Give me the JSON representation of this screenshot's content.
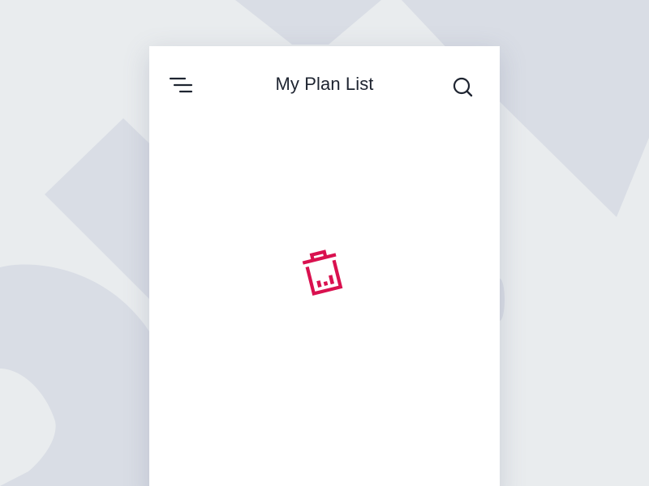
{
  "header": {
    "title": "My Plan List",
    "menu_icon": "menu-icon",
    "search_icon": "search-icon"
  },
  "content": {
    "center_icon": "trash-icon"
  },
  "colors": {
    "background": "#e9ecee",
    "background_shapes": "#d9dde5",
    "card": "#ffffff",
    "text": "#1e2430",
    "accent": "#d9114f"
  }
}
